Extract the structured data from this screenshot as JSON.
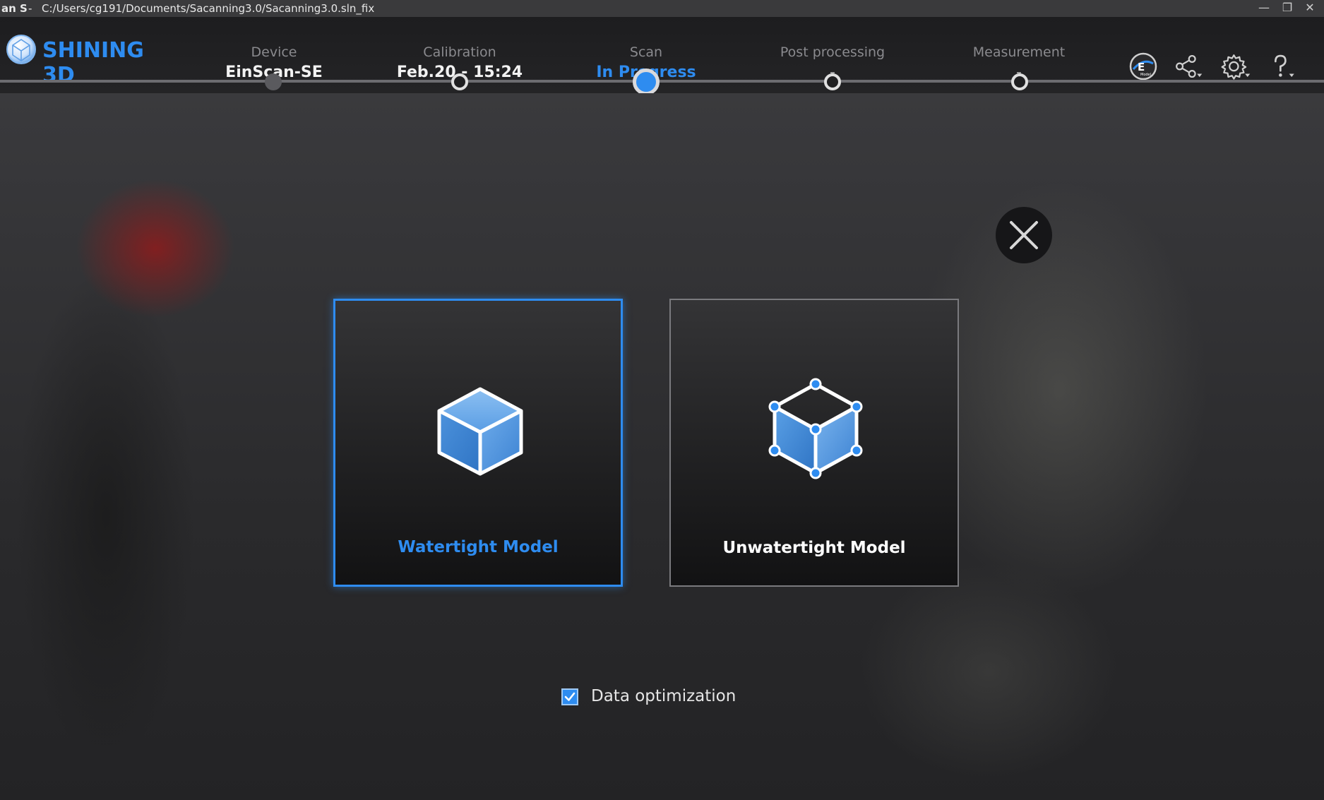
{
  "titlebar": {
    "app_name": "an S",
    "separator": "-",
    "path": "C:/Users/cg191/Documents/Sacanning3.0/Sacanning3.0.sln_fix",
    "minimize_glyph": "—",
    "restore_glyph": "❐",
    "close_glyph": "✕"
  },
  "brand": {
    "name": "SHINING 3D",
    "color": "#2e8cf0"
  },
  "steps": [
    {
      "label": "Device",
      "value": "EinScan-SE",
      "state": "done"
    },
    {
      "label": "Calibration",
      "value": "Feb.20 - 15:24",
      "state": "pending"
    },
    {
      "label": "Scan",
      "value": "In Progress",
      "state": "active"
    },
    {
      "label": "Post processing",
      "value": "-",
      "state": "pending"
    },
    {
      "label": "Measurement",
      "value": "-",
      "state": "pending"
    }
  ],
  "header_icons": {
    "ez_badge": "E",
    "ez_sub": "Model",
    "share": "share-icon",
    "settings": "gear-icon",
    "help": "help-icon"
  },
  "dialog": {
    "options": [
      {
        "title": "Watertight Model",
        "selected": true
      },
      {
        "title": "Unwatertight Model",
        "selected": false
      }
    ],
    "data_optimization": {
      "label": "Data optimization",
      "checked": true
    }
  },
  "colors": {
    "accent": "#2e8cf0",
    "background": "#2b2b2e",
    "header": "#1d1d1f"
  }
}
